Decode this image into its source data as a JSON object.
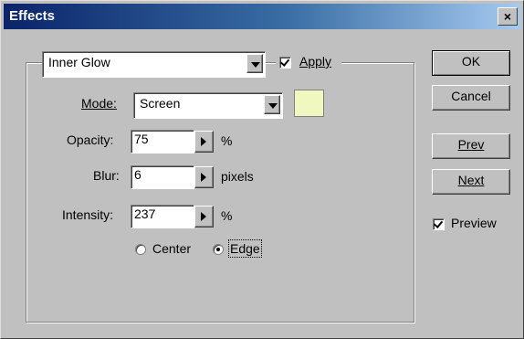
{
  "window": {
    "title": "Effects",
    "close_glyph": "×"
  },
  "effect_select": {
    "value": "Inner Glow"
  },
  "apply": {
    "label": "Apply",
    "checked": true
  },
  "mode": {
    "label": "Mode:",
    "value": "Screen",
    "color": "#f0f8c0"
  },
  "opacity": {
    "label": "Opacity:",
    "value": "75",
    "unit": "%"
  },
  "blur": {
    "label": "Blur:",
    "value": "6",
    "unit": "pixels"
  },
  "intensity": {
    "label": "Intensity:",
    "value": "237",
    "unit": "%"
  },
  "position": {
    "center_label": "Center",
    "edge_label": "Edge",
    "selected": "Edge"
  },
  "buttons": {
    "ok": "OK",
    "cancel": "Cancel",
    "prev": "Prev",
    "next": "Next"
  },
  "preview": {
    "label": "Preview",
    "checked": true
  },
  "icons": {
    "dropdown": "chevron-down-icon",
    "stepper": "triangle-right-icon",
    "close": "close-icon"
  }
}
